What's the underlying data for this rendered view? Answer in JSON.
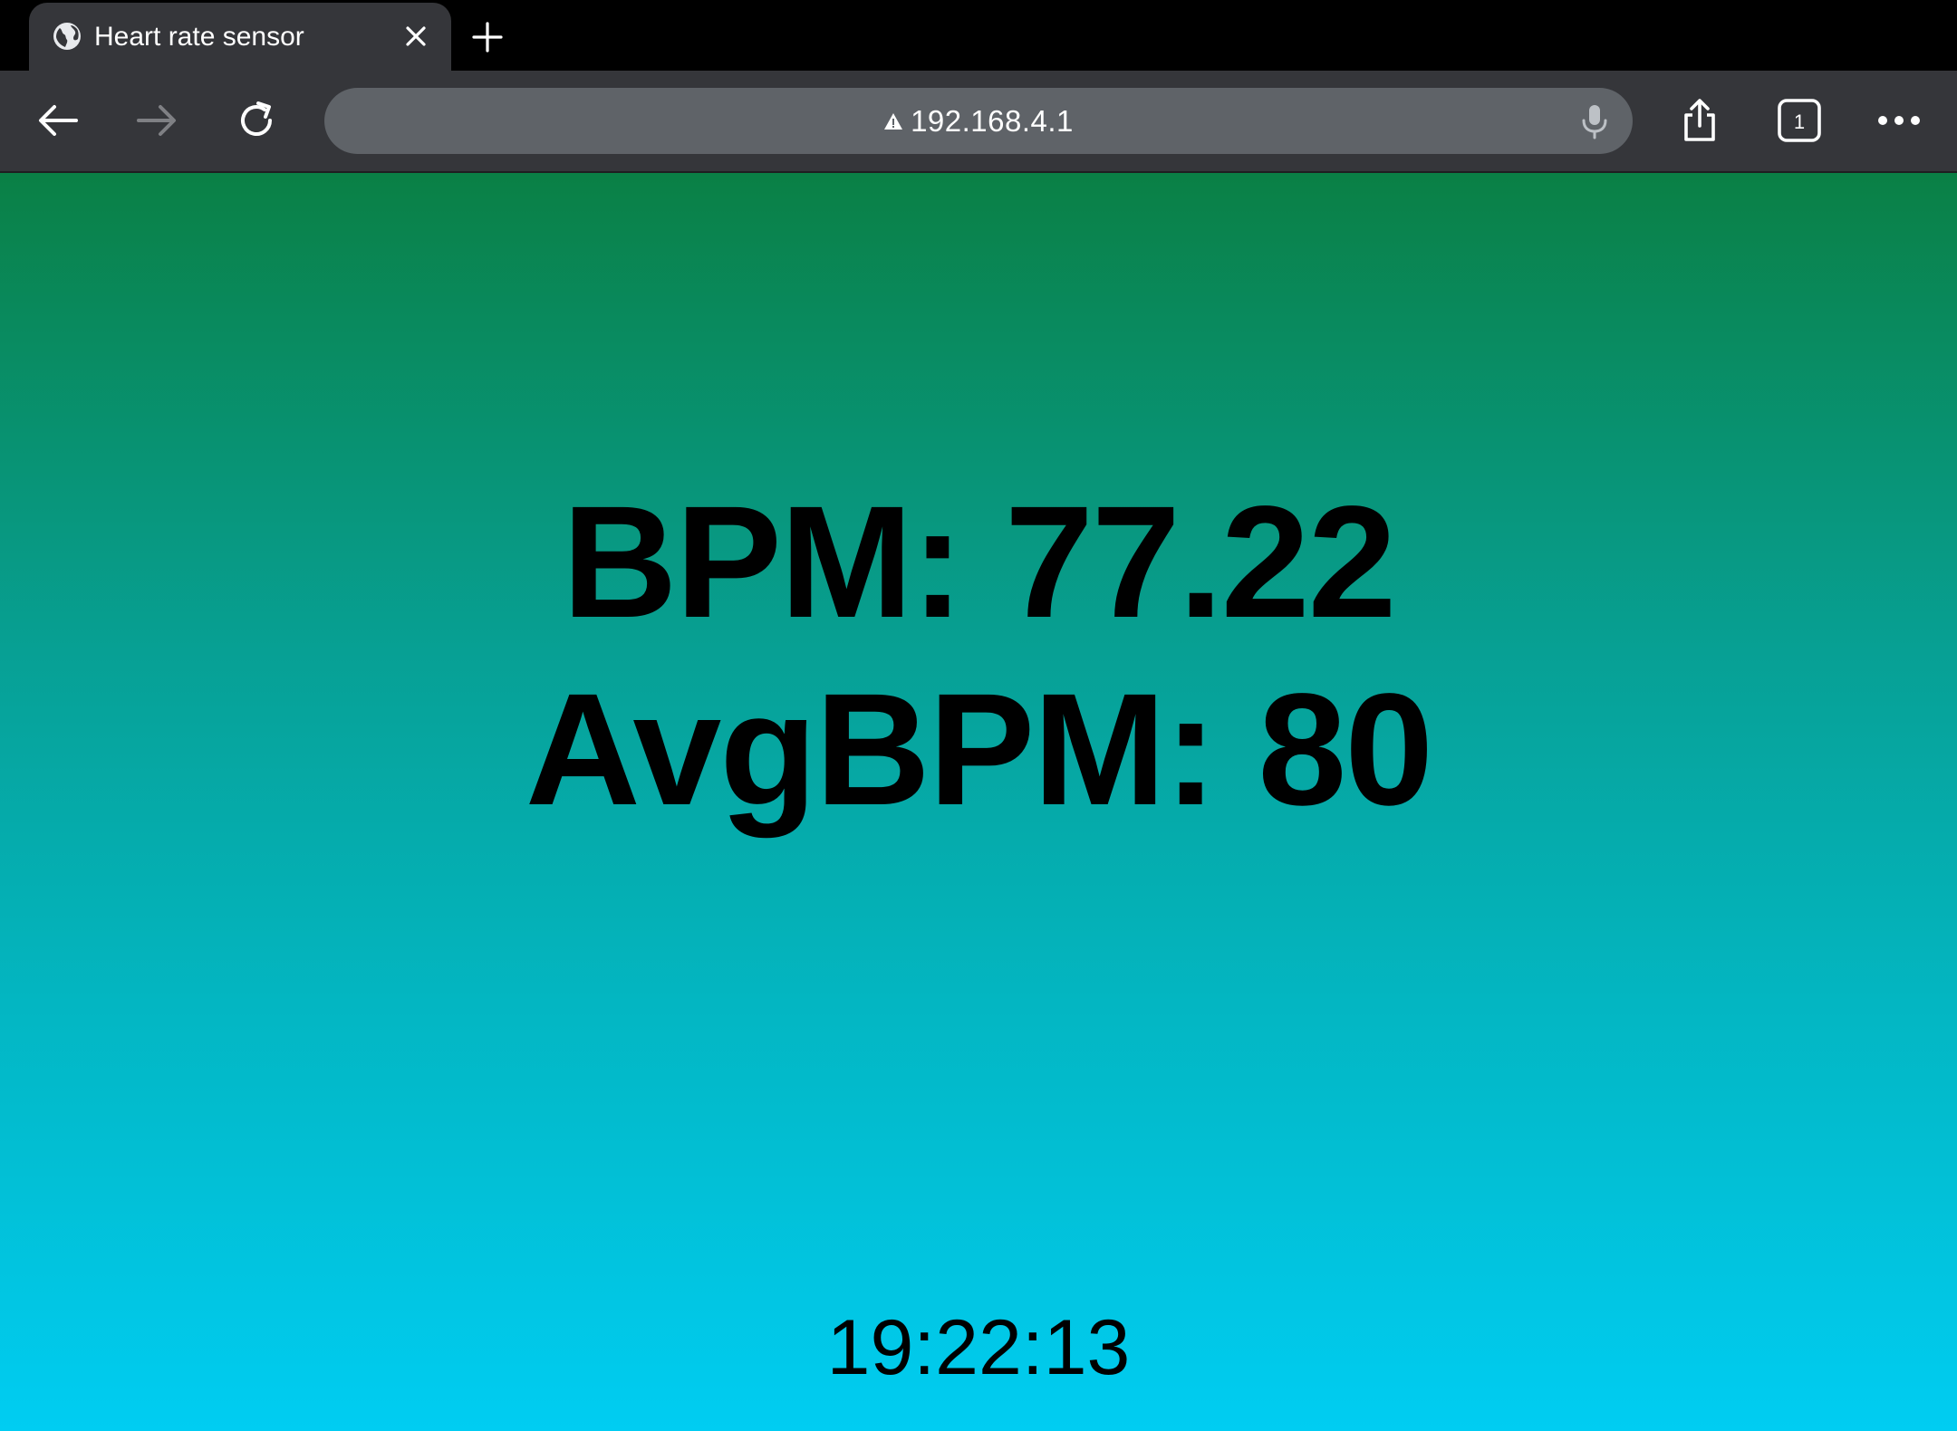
{
  "browser": {
    "tab": {
      "title": "Heart rate sensor",
      "favicon": "globe-icon",
      "close_icon": "close-icon"
    },
    "new_tab_icon": "plus-icon",
    "toolbar": {
      "back_icon": "back-arrow-icon",
      "forward_icon": "forward-arrow-icon",
      "reload_icon": "reload-icon",
      "security_icon": "warning-icon",
      "url": "192.168.4.1",
      "mic_icon": "microphone-icon",
      "share_icon": "share-icon",
      "tab_count": "1",
      "menu_icon": "more-icon"
    },
    "colors": {
      "tabbar_bg": "#000000",
      "toolbar_bg": "#35363a",
      "omnibox_bg": "#5f6368"
    }
  },
  "page": {
    "bpm": "BPM: 77.22",
    "avg_bpm": "AvgBPM: 80",
    "time": "19:22:13",
    "colors": {
      "gradient_top": "#0a8045",
      "gradient_bottom": "#00cdf2",
      "text": "#000000"
    }
  }
}
